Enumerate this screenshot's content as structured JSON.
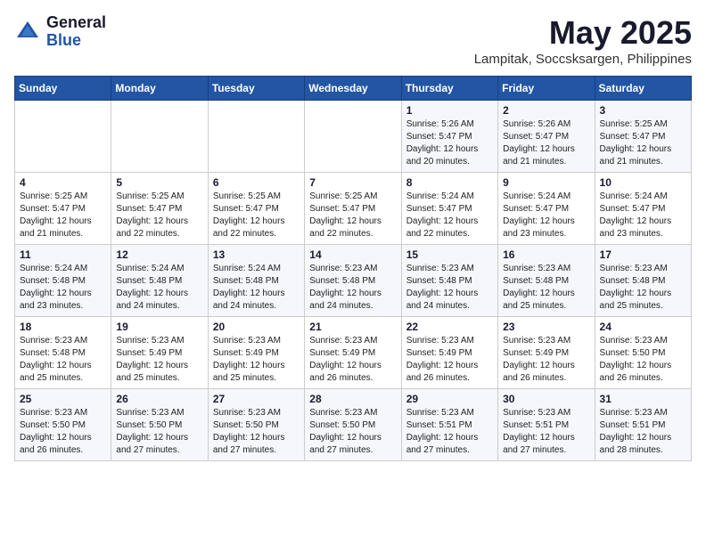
{
  "header": {
    "logo": {
      "general": "General",
      "blue": "Blue"
    },
    "title": "May 2025",
    "subtitle": "Lampitak, Soccsksargen, Philippines"
  },
  "weekdays": [
    "Sunday",
    "Monday",
    "Tuesday",
    "Wednesday",
    "Thursday",
    "Friday",
    "Saturday"
  ],
  "weeks": [
    [
      {
        "day": "",
        "info": ""
      },
      {
        "day": "",
        "info": ""
      },
      {
        "day": "",
        "info": ""
      },
      {
        "day": "",
        "info": ""
      },
      {
        "day": "1",
        "info": "Sunrise: 5:26 AM\nSunset: 5:47 PM\nDaylight: 12 hours\nand 20 minutes."
      },
      {
        "day": "2",
        "info": "Sunrise: 5:26 AM\nSunset: 5:47 PM\nDaylight: 12 hours\nand 21 minutes."
      },
      {
        "day": "3",
        "info": "Sunrise: 5:25 AM\nSunset: 5:47 PM\nDaylight: 12 hours\nand 21 minutes."
      }
    ],
    [
      {
        "day": "4",
        "info": "Sunrise: 5:25 AM\nSunset: 5:47 PM\nDaylight: 12 hours\nand 21 minutes."
      },
      {
        "day": "5",
        "info": "Sunrise: 5:25 AM\nSunset: 5:47 PM\nDaylight: 12 hours\nand 22 minutes."
      },
      {
        "day": "6",
        "info": "Sunrise: 5:25 AM\nSunset: 5:47 PM\nDaylight: 12 hours\nand 22 minutes."
      },
      {
        "day": "7",
        "info": "Sunrise: 5:25 AM\nSunset: 5:47 PM\nDaylight: 12 hours\nand 22 minutes."
      },
      {
        "day": "8",
        "info": "Sunrise: 5:24 AM\nSunset: 5:47 PM\nDaylight: 12 hours\nand 22 minutes."
      },
      {
        "day": "9",
        "info": "Sunrise: 5:24 AM\nSunset: 5:47 PM\nDaylight: 12 hours\nand 23 minutes."
      },
      {
        "day": "10",
        "info": "Sunrise: 5:24 AM\nSunset: 5:47 PM\nDaylight: 12 hours\nand 23 minutes."
      }
    ],
    [
      {
        "day": "11",
        "info": "Sunrise: 5:24 AM\nSunset: 5:48 PM\nDaylight: 12 hours\nand 23 minutes."
      },
      {
        "day": "12",
        "info": "Sunrise: 5:24 AM\nSunset: 5:48 PM\nDaylight: 12 hours\nand 24 minutes."
      },
      {
        "day": "13",
        "info": "Sunrise: 5:24 AM\nSunset: 5:48 PM\nDaylight: 12 hours\nand 24 minutes."
      },
      {
        "day": "14",
        "info": "Sunrise: 5:23 AM\nSunset: 5:48 PM\nDaylight: 12 hours\nand 24 minutes."
      },
      {
        "day": "15",
        "info": "Sunrise: 5:23 AM\nSunset: 5:48 PM\nDaylight: 12 hours\nand 24 minutes."
      },
      {
        "day": "16",
        "info": "Sunrise: 5:23 AM\nSunset: 5:48 PM\nDaylight: 12 hours\nand 25 minutes."
      },
      {
        "day": "17",
        "info": "Sunrise: 5:23 AM\nSunset: 5:48 PM\nDaylight: 12 hours\nand 25 minutes."
      }
    ],
    [
      {
        "day": "18",
        "info": "Sunrise: 5:23 AM\nSunset: 5:48 PM\nDaylight: 12 hours\nand 25 minutes."
      },
      {
        "day": "19",
        "info": "Sunrise: 5:23 AM\nSunset: 5:49 PM\nDaylight: 12 hours\nand 25 minutes."
      },
      {
        "day": "20",
        "info": "Sunrise: 5:23 AM\nSunset: 5:49 PM\nDaylight: 12 hours\nand 25 minutes."
      },
      {
        "day": "21",
        "info": "Sunrise: 5:23 AM\nSunset: 5:49 PM\nDaylight: 12 hours\nand 26 minutes."
      },
      {
        "day": "22",
        "info": "Sunrise: 5:23 AM\nSunset: 5:49 PM\nDaylight: 12 hours\nand 26 minutes."
      },
      {
        "day": "23",
        "info": "Sunrise: 5:23 AM\nSunset: 5:49 PM\nDaylight: 12 hours\nand 26 minutes."
      },
      {
        "day": "24",
        "info": "Sunrise: 5:23 AM\nSunset: 5:50 PM\nDaylight: 12 hours\nand 26 minutes."
      }
    ],
    [
      {
        "day": "25",
        "info": "Sunrise: 5:23 AM\nSunset: 5:50 PM\nDaylight: 12 hours\nand 26 minutes."
      },
      {
        "day": "26",
        "info": "Sunrise: 5:23 AM\nSunset: 5:50 PM\nDaylight: 12 hours\nand 27 minutes."
      },
      {
        "day": "27",
        "info": "Sunrise: 5:23 AM\nSunset: 5:50 PM\nDaylight: 12 hours\nand 27 minutes."
      },
      {
        "day": "28",
        "info": "Sunrise: 5:23 AM\nSunset: 5:50 PM\nDaylight: 12 hours\nand 27 minutes."
      },
      {
        "day": "29",
        "info": "Sunrise: 5:23 AM\nSunset: 5:51 PM\nDaylight: 12 hours\nand 27 minutes."
      },
      {
        "day": "30",
        "info": "Sunrise: 5:23 AM\nSunset: 5:51 PM\nDaylight: 12 hours\nand 27 minutes."
      },
      {
        "day": "31",
        "info": "Sunrise: 5:23 AM\nSunset: 5:51 PM\nDaylight: 12 hours\nand 28 minutes."
      }
    ]
  ]
}
